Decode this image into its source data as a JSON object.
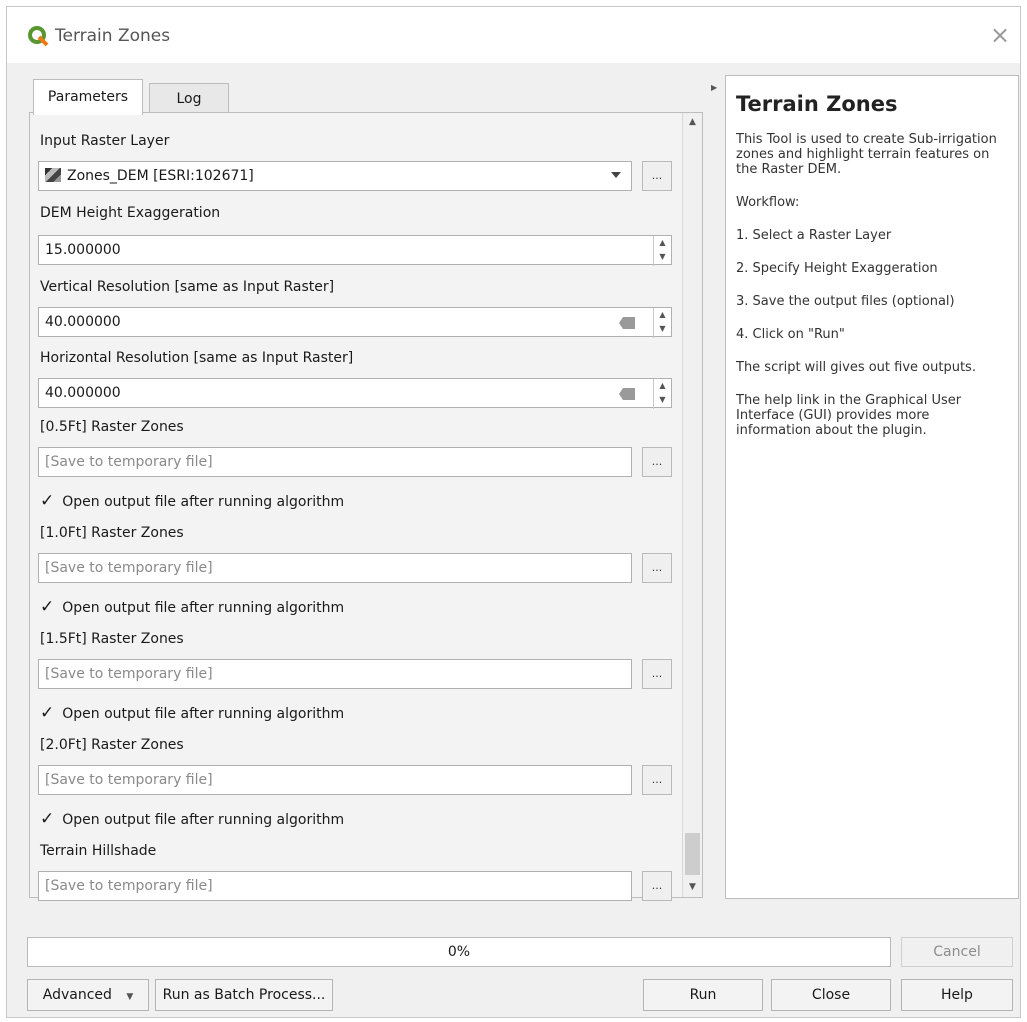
{
  "window": {
    "title": "Terrain Zones"
  },
  "tabs": [
    {
      "label": "Parameters"
    },
    {
      "label": "Log"
    }
  ],
  "params": {
    "input_raster": {
      "label": "Input Raster Layer",
      "value": "Zones_DEM [ESRI:102671]"
    },
    "dem_height": {
      "label": "DEM Height Exaggeration",
      "value": "15.000000"
    },
    "vertical_res": {
      "label": "Vertical Resolution [same as Input Raster]",
      "value": "40.000000"
    },
    "horizontal_res": {
      "label": "Horizontal Resolution [same as Input Raster]",
      "value": "40.000000"
    },
    "zone_05": {
      "label": "[0.5Ft] Raster Zones",
      "placeholder": "[Save to temporary file]",
      "checkbox": "Open output file after running algorithm"
    },
    "zone_10": {
      "label": "[1.0Ft] Raster Zones",
      "placeholder": "[Save to temporary file]",
      "checkbox": "Open output file after running algorithm"
    },
    "zone_15": {
      "label": "[1.5Ft] Raster Zones",
      "placeholder": "[Save to temporary file]",
      "checkbox": "Open output file after running algorithm"
    },
    "zone_20": {
      "label": "[2.0Ft] Raster Zones",
      "placeholder": "[Save to temporary file]",
      "checkbox": "Open output file after running algorithm"
    },
    "hillshade": {
      "label": "Terrain Hillshade",
      "placeholder": "[Save to temporary file]"
    },
    "browse_label": "...",
    "check_mark": "✓"
  },
  "help": {
    "title": "Terrain Zones",
    "description": "This Tool is used to create Sub-irrigation zones and highlight terrain features on the Raster DEM.",
    "workflow": "Workflow:",
    "step1": "1. Select a Raster Layer",
    "step2": "2. Specify Height Exaggeration",
    "step3": "3. Save the output files (optional)",
    "step4": "4. Click on \"Run\"",
    "outputs": "The script will gives out five outputs.",
    "link_note": "The help link in the Graphical User Interface (GUI) provides more information about the plugin."
  },
  "progress": {
    "text": "0%",
    "value": 0
  },
  "buttons": {
    "cancel": "Cancel",
    "advanced": "Advanced",
    "batch": "Run as Batch Process...",
    "run": "Run",
    "close": "Close",
    "help": "Help"
  },
  "colors": {
    "qgis_green": "#589632",
    "qgis_yellow": "#ee7913"
  }
}
